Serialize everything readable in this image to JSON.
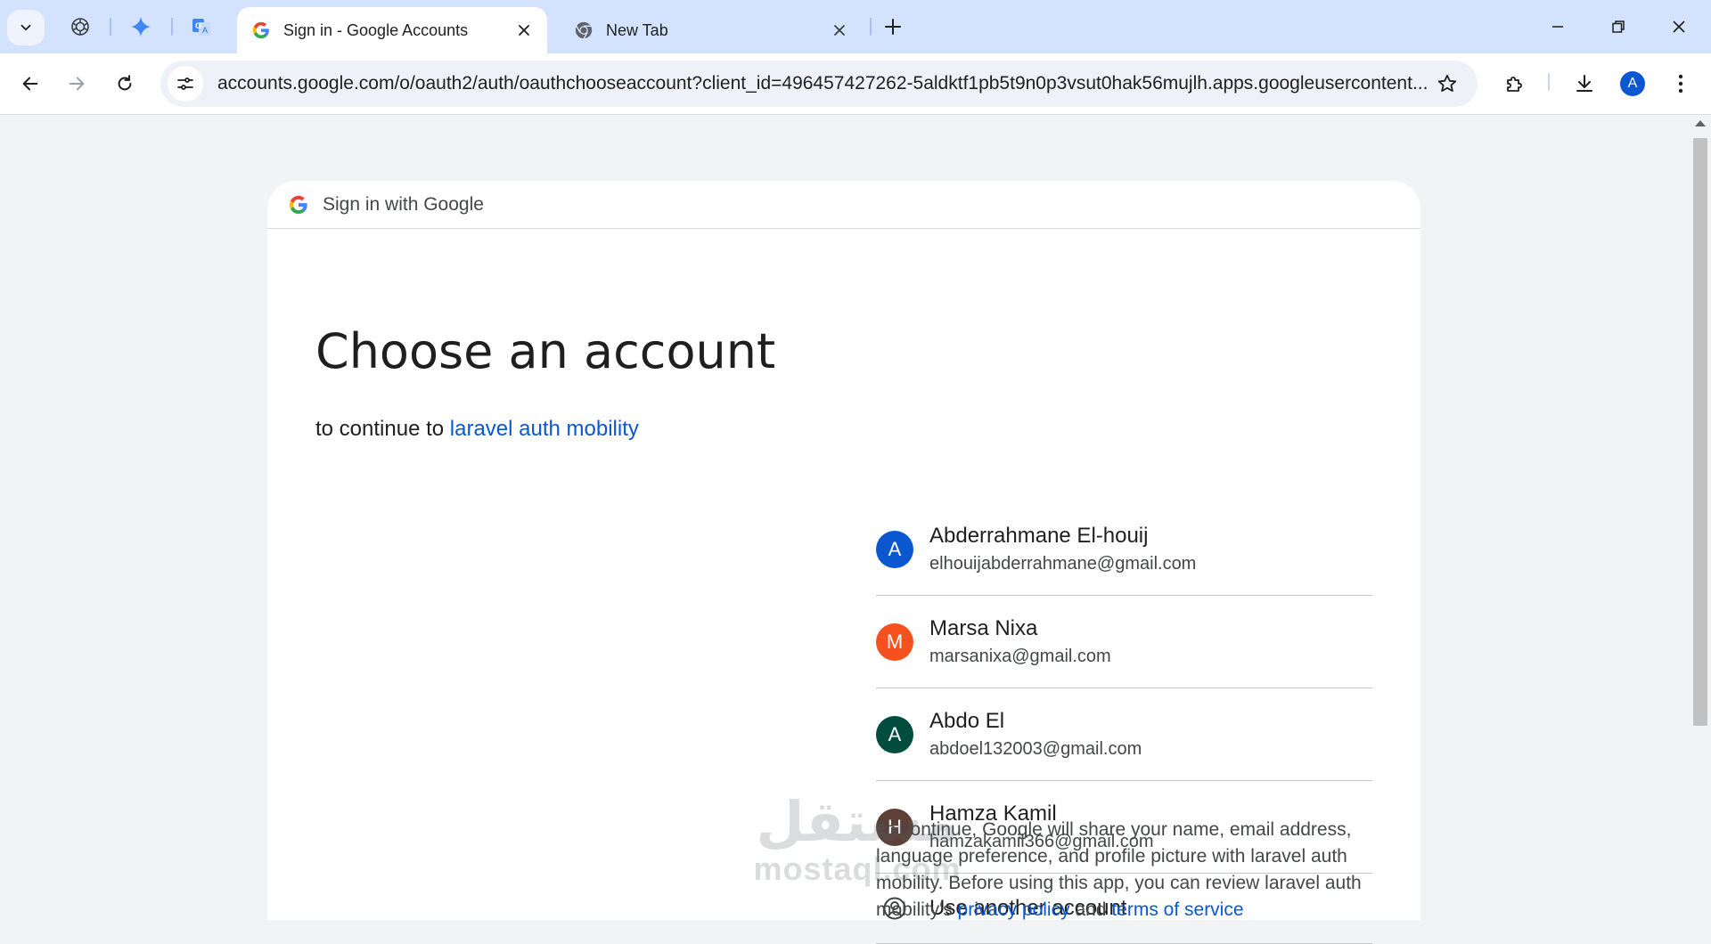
{
  "browser": {
    "tabs": [
      {
        "title": "Sign in - Google Accounts",
        "active": true
      },
      {
        "title": "New Tab",
        "active": false
      }
    ],
    "pinned_tabs": [
      "chatgpt-icon",
      "gemini-icon",
      "google-translate-icon"
    ],
    "url": "accounts.google.com/o/oauth2/auth/oauthchooseaccount?client_id=496457427262-5aldktf1pb5t9n0p3vsut0hak56mujlh.apps.googleusercontent...",
    "profile_initial": "A"
  },
  "card": {
    "header_title": "Sign in with Google",
    "title": "Choose an account",
    "subtitle_prefix": "to continue to",
    "app_name": "laravel auth mobility",
    "accounts": [
      {
        "initial": "A",
        "name": "Abderrahmane El-houij",
        "email": "elhouijabderrahmane@gmail.com",
        "color": "#0b57d0"
      },
      {
        "initial": "M",
        "name": "Marsa Nixa",
        "email": "marsanixa@gmail.com",
        "color": "#f4511e"
      },
      {
        "initial": "A",
        "name": "Abdo El",
        "email": "abdoel132003@gmail.com",
        "color": "#004d40"
      },
      {
        "initial": "H",
        "name": "Hamza Kamil",
        "email": "hamzakamil366@gmail.com",
        "color": "#5d4037"
      }
    ],
    "use_another": "Use another account",
    "notice_text": "To continue, Google will share your name, email address, language preference, and profile picture with laravel auth mobility. Before using this app, you can review laravel auth",
    "notice_tail": "mobility's",
    "notice_link_privacy": "privacy policy",
    "notice_and": "and",
    "notice_link_terms": "terms of service"
  },
  "watermark": {
    "arabic": "مستقل",
    "latin": "mostaql.com"
  },
  "colors": {
    "accent": "#0b57d0",
    "tabstrip": "#d3e3fd",
    "page_bg": "#f1f3f4"
  }
}
